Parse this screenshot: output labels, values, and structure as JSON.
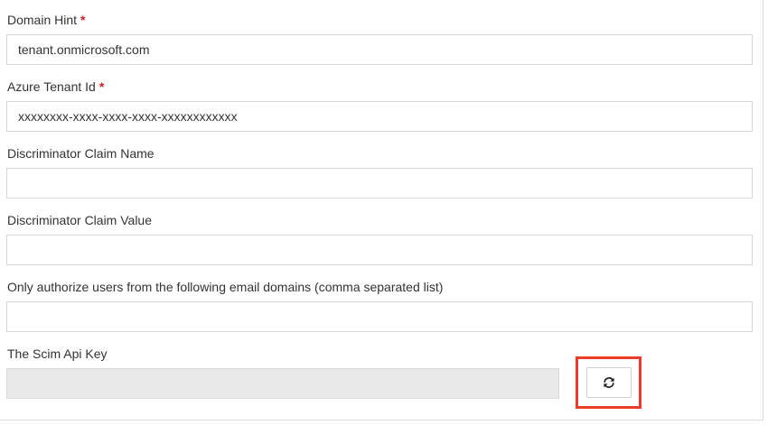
{
  "form": {
    "domain_hint": {
      "label": "Domain Hint",
      "required_marker": "*",
      "value": "tenant.onmicrosoft.com"
    },
    "azure_tenant_id": {
      "label": "Azure Tenant Id",
      "required_marker": "*",
      "value": "xxxxxxxx-xxxx-xxxx-xxxx-xxxxxxxxxxxx"
    },
    "discriminator_claim_name": {
      "label": "Discriminator Claim Name",
      "value": ""
    },
    "discriminator_claim_value": {
      "label": "Discriminator Claim Value",
      "value": ""
    },
    "authorized_email_domains": {
      "label": "Only authorize users from the following email domains (comma separated list)",
      "value": ""
    },
    "scim_api_key": {
      "label": "The Scim Api Key",
      "value": "",
      "regenerate_button_icon": "refresh-icon"
    }
  },
  "colors": {
    "required": "#cc1f1f",
    "highlight": "#f03a2a",
    "readonly_field": "#e9e9e9"
  }
}
